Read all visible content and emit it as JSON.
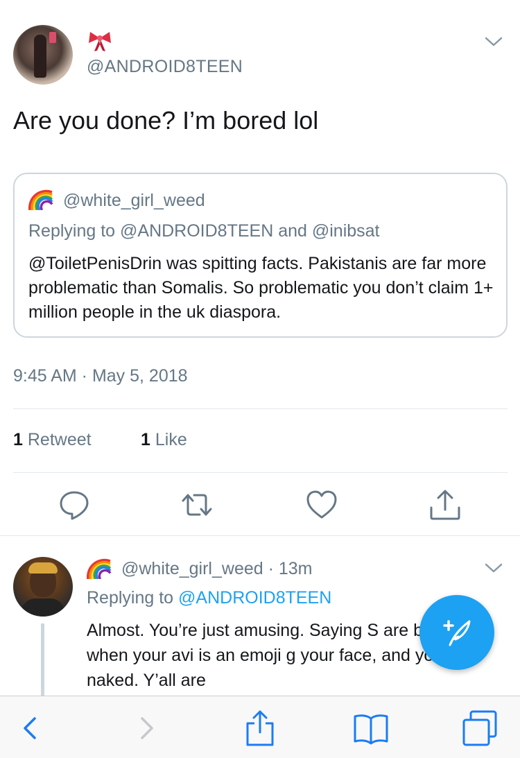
{
  "main_tweet": {
    "emoji": "bow",
    "handle": "@ANDROID8TEEN",
    "text": "Are you done? I’m bored lol",
    "quoted": {
      "emoji": "rainbow",
      "handle": "@white_girl_weed",
      "replying_to": "Replying to @ANDROID8TEEN and @inibsat",
      "body": "@ToiletPenisDrin was spitting facts. Pakistanis are far more problematic than Somalis. So problematic you don’t claim 1+ million people in the uk diaspora."
    },
    "timestamp": "9:45 AM · May 5, 2018",
    "stats": {
      "retweet_count": "1",
      "retweet_label": "Retweet",
      "like_count": "1",
      "like_label": "Like"
    }
  },
  "reply_tweet": {
    "emoji": "rainbow",
    "handle_line": "@white_girl_weed · 13m",
    "replying_prefix": "Replying to ",
    "replying_handle": "@ANDROID8TEEN",
    "body": "Almost. You’re just amusing. Saying S are busted, when your avi is an emoji g your face, and you half naked. Y’all are"
  },
  "colors": {
    "accent": "#1da1f2",
    "secondary_text": "#657786",
    "primary_text": "#14171a",
    "border": "#ccd6dd"
  },
  "icons": {
    "actions": [
      "reply-icon",
      "retweet-icon",
      "like-icon",
      "share-icon"
    ],
    "toolbar": [
      "back-icon",
      "forward-icon",
      "share-icon",
      "bookmarks-icon",
      "tabs-icon"
    ],
    "fab": "compose-tweet-icon"
  }
}
